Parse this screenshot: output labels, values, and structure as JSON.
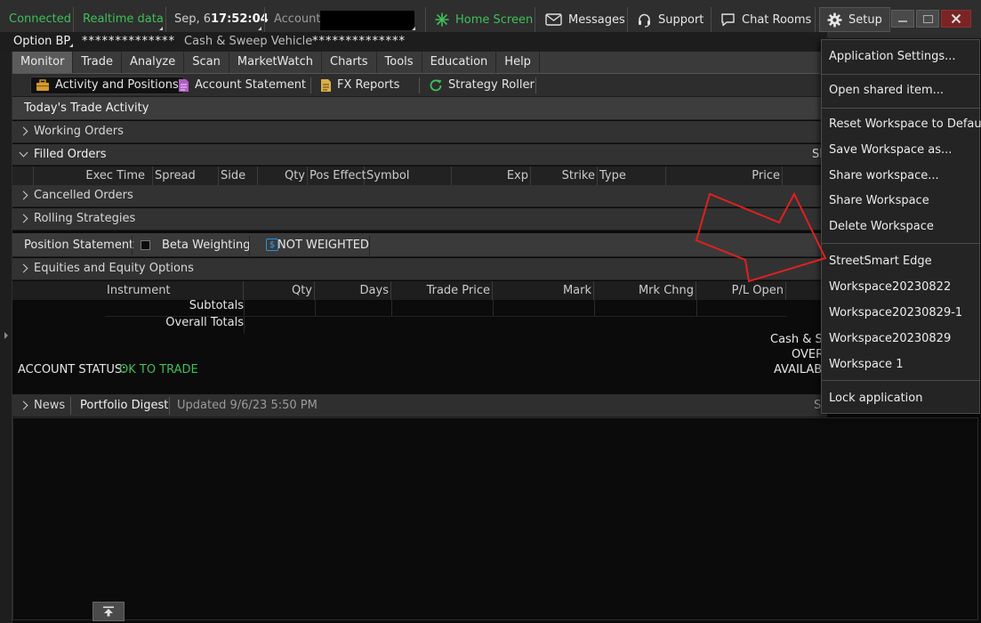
{
  "status": {
    "connected": "Connected",
    "realtime": "Realtime data",
    "date": "Sep, 6",
    "time": "17:52:04",
    "account_label": "Account:"
  },
  "toolbar": {
    "home": "Home Screen",
    "messages": "Messages",
    "support": "Support",
    "chat_rooms": "Chat Rooms",
    "setup": "Setup"
  },
  "balances": {
    "option_bp_label": "Option BP",
    "option_bp_value": "**************",
    "cash_label": "Cash & Sweep Vehicle",
    "cash_value": "**************"
  },
  "main_menu": [
    "Monitor",
    "Trade",
    "Analyze",
    "Scan",
    "MarketWatch",
    "Charts",
    "Tools",
    "Education",
    "Help"
  ],
  "sub_tabs": {
    "activity": "Activity and Positions",
    "account_statement": "Account Statement",
    "fx_reports": "FX Reports",
    "strategy_roller": "Strategy Roller"
  },
  "trade_activity": {
    "title": "Today's Trade Activity",
    "working_orders": "Working Orders",
    "filled_orders": "Filled Orders",
    "filled_right": "Sl",
    "columns": [
      "Exec Time",
      "Spread",
      "Side",
      "Qty",
      "Pos Effect",
      "Symbol",
      "Exp",
      "Strike",
      "Type",
      "Price"
    ],
    "cancelled_orders": "Cancelled Orders",
    "rolling_strategies": "Rolling Strategies"
  },
  "position": {
    "title": "Position Statement",
    "beta_weighting": "Beta Weighting",
    "not_weighted": "NOT WEIGHTED",
    "equities": "Equities and Equity Options",
    "columns": [
      "Instrument",
      "Qty",
      "Days",
      "Trade Price",
      "Mark",
      "Mrk Chng",
      "P/L Open"
    ],
    "subtotals": "Subtotals",
    "overall_totals": "Overall Totals",
    "cash_sweep": "Cash & Sw",
    "over": "OVER",
    "availab": "AVAILAB",
    "account_status_label": "ACCOUNT STATUS:",
    "account_status_value": "OK TO TRADE"
  },
  "news_bar": {
    "news": "News",
    "portfolio_digest": "Portfolio Digest",
    "updated": "Updated 9/6/23 5:50 PM",
    "right_trunc": "S"
  },
  "setup_menu": [
    "Application Settings...",
    "Open shared item...",
    "Reset Workspace to Default",
    "Save Workspace as...",
    "Share workspace...",
    "Share Workspace",
    "Delete Workspace",
    "StreetSmart Edge",
    "Workspace20230822",
    "Workspace20230829-1",
    "Workspace20230829",
    "Workspace 1",
    "Lock application"
  ],
  "colors": {
    "green": "#3fbf5a",
    "annotation_red": "#e02020",
    "accent_blue": "#2d8fd6"
  }
}
